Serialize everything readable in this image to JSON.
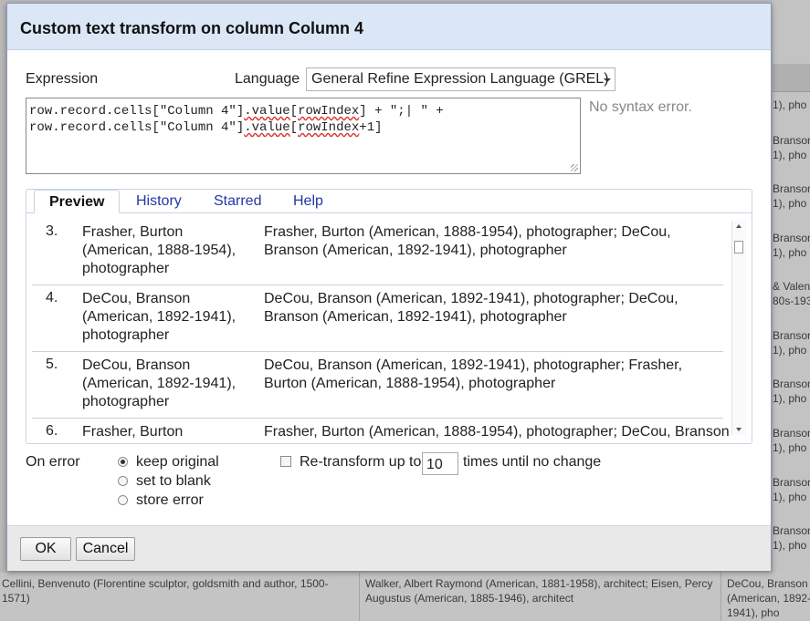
{
  "dialog": {
    "title": "Custom text transform on column Column 4",
    "expression_label": "Expression",
    "language_label": "Language",
    "language_value": "General Refine Expression Language (GREL)",
    "expression_parts": {
      "line1_a": "row.record.cells[\"Column 4\"]",
      "line1_b": ".value",
      "line1_c": "[",
      "line1_d": "rowIndex",
      "line1_e": "] + \";| \" +",
      "line2_a": "row.record.cells[\"Column 4\"]",
      "line2_b": ".value",
      "line2_c": "[",
      "line2_d": "rowIndex",
      "line2_e": "+1]"
    },
    "syntax_status": "No syntax error.",
    "tabs": [
      {
        "label": "Preview"
      },
      {
        "label": "History"
      },
      {
        "label": "Starred"
      },
      {
        "label": "Help"
      }
    ],
    "preview_rows": [
      {
        "num": "3.",
        "original": "Frasher, Burton (American, 1888-1954), photographer",
        "result": "Frasher, Burton (American, 1888-1954), photographer; DeCou, Branson (American, 1892-1941), photographer"
      },
      {
        "num": "4.",
        "original": "DeCou, Branson (American, 1892-1941), photographer",
        "result": "DeCou, Branson (American, 1892-1941), photographer; DeCou, Branson (American, 1892-1941), photographer"
      },
      {
        "num": "5.",
        "original": "DeCou, Branson (American, 1892-1941), photographer",
        "result": "DeCou, Branson (American, 1892-1941), photographer; Frasher, Burton (American, 1888-1954), photographer"
      },
      {
        "num": "6.",
        "original": "Frasher, Burton",
        "result": "Frasher, Burton (American, 1888-1954), photographer; DeCou, Branson"
      }
    ],
    "on_error_label": "On error",
    "on_error_options": [
      {
        "label": "keep original",
        "checked": true
      },
      {
        "label": "set to blank",
        "checked": false
      },
      {
        "label": "store error",
        "checked": false
      }
    ],
    "retransform_label": "Re-transform up to",
    "retransform_value": "10",
    "retransform_suffix": "times until no change",
    "ok_label": "OK",
    "cancel_label": "Cancel"
  },
  "background": {
    "right_fragments": [
      "1), pho",
      "Branson",
      "1), pho",
      "Branson",
      "1), pho",
      "Branson",
      "1), pho",
      "& Valen",
      "80s-193",
      "Branson",
      "1), pho",
      "Branson",
      "1), pho",
      "Branson",
      "1), pho",
      "Branson",
      "1), pho",
      "Branson",
      "1), pho",
      "Branson",
      "1), pho"
    ],
    "bottom_cells": [
      "Cellini, Benvenuto (Florentine sculptor, goldsmith and author, 1500-1571)",
      "Walker, Albert Raymond (American, 1881-1958), architect; Eisen, Percy Augustus (American, 1885-1946), architect",
      "DeCou, Branson (American, 1892-1941), pho"
    ]
  }
}
